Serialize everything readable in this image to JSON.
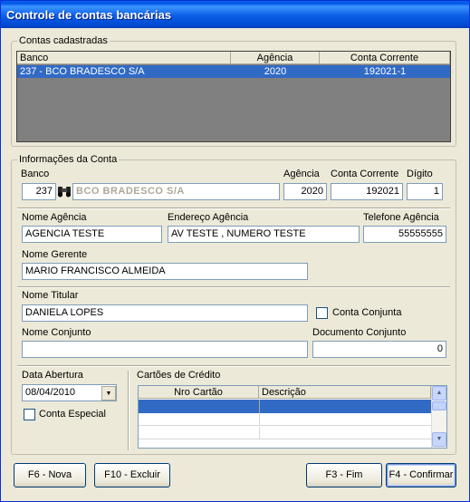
{
  "window": {
    "title": "Controle de contas bancárias"
  },
  "contas": {
    "legend": "Contas cadastradas",
    "columns": [
      "Banco",
      "Agência",
      "Conta Corrente"
    ],
    "rows": [
      {
        "banco": "237 - BCO BRADESCO S/A",
        "agencia": "2020",
        "conta": "192021-1"
      }
    ]
  },
  "info": {
    "legend": "Informações da Conta",
    "banco_label": "Banco",
    "banco_codigo": "237",
    "banco_nome": "BCO BRADESCO S/A",
    "agencia_label": "Agência",
    "agencia_value": "2020",
    "conta_label": "Conta Corrente",
    "conta_value": "192021",
    "digito_label": "Dígito",
    "digito_value": "1",
    "nome_agencia_label": "Nome Agência",
    "nome_agencia_value": "AGENCIA TESTE",
    "endereco_label": "Endereço Agência",
    "endereco_value": "AV TESTE , NUMERO TESTE",
    "telefone_label": "Telefone Agência",
    "telefone_value": "55555555",
    "gerente_label": "Nome Gerente",
    "gerente_value": "MARIO FRANCISCO ALMEIDA",
    "titular_label": "Nome Titular",
    "titular_value": "DANIELA LOPES",
    "conjunta_label": "Conta Conjunta",
    "conjunta_checked": false,
    "nome_conjunto_label": "Nome Conjunto",
    "nome_conjunto_value": "",
    "doc_conjunto_label": "Documento Conjunto",
    "doc_conjunto_value": "0",
    "data_abertura_label": "Data Abertura",
    "data_abertura_value": "08/04/2010",
    "especial_label": "Conta Especial",
    "especial_checked": false,
    "cartoes_label": "Cartões de Crédito",
    "cartoes_columns": [
      "Nro Cartão",
      "Descrição"
    ]
  },
  "buttons": {
    "nova": "F6 - Nova",
    "excluir": "F10 - Excluir",
    "fim": "F3 - Fim",
    "confirmar": "F4 - Confirmar"
  },
  "colors": {
    "selection": "#316ac5",
    "titlebar": "#0a5fe6",
    "face": "#ece9d8"
  },
  "icons": {
    "search": "binoculars-icon",
    "dropdown": "chevron-down-icon"
  }
}
